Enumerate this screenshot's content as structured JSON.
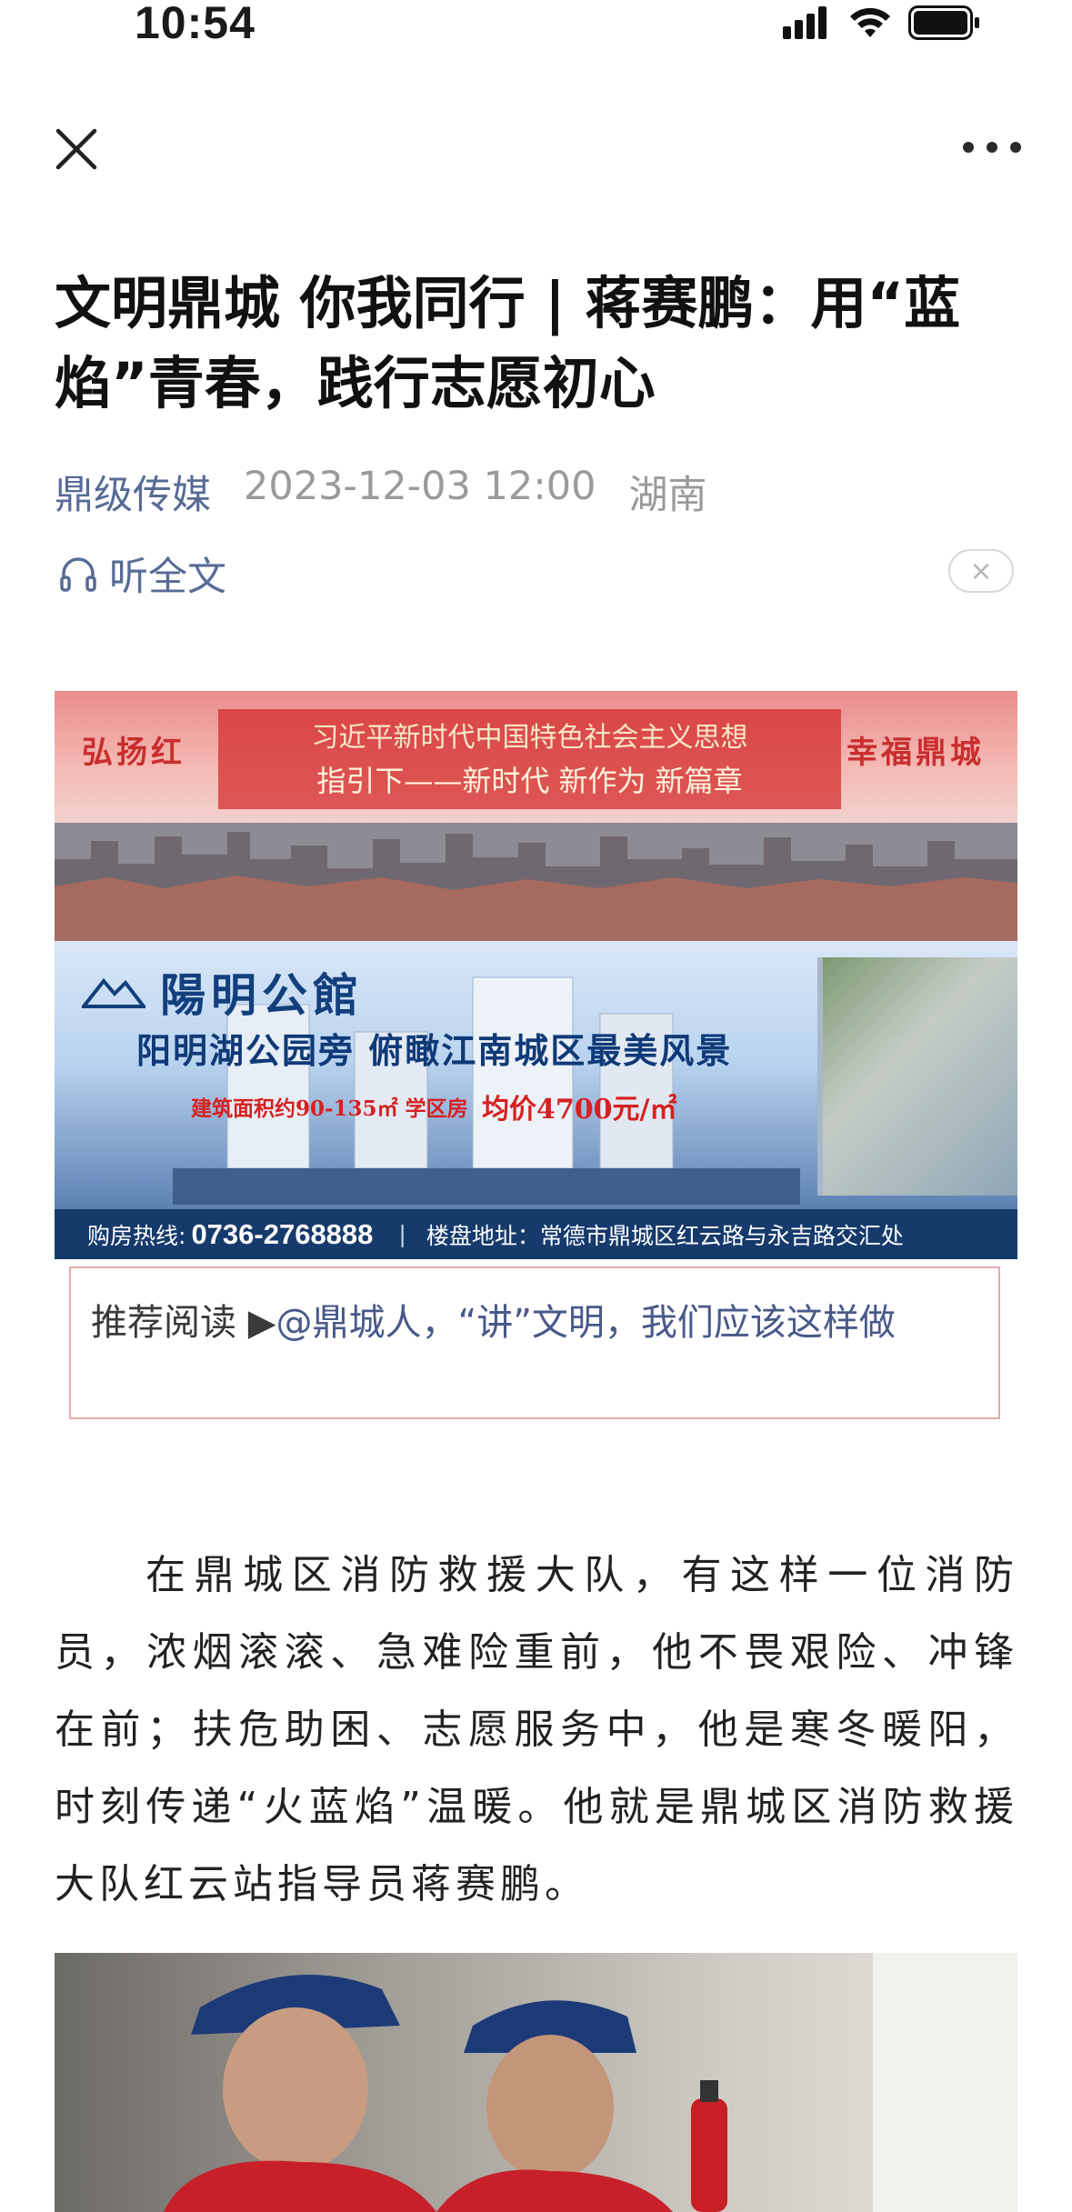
{
  "status_bar": {
    "time": "10:54"
  },
  "nav": {
    "close_icon": "close-icon",
    "more_icon": "more-icon"
  },
  "article": {
    "title": "文明鼎城 你我同行 | 蒋赛鹏：用“蓝焰”青春，践行志愿初心",
    "source": "鼎级传媒",
    "datetime": "2023-12-03 12:00",
    "location": "湖南",
    "listen_label": "听全文",
    "close_glyph": "×"
  },
  "banner": {
    "slogan_left": "弘扬红",
    "slogan_right": "幸福鼎城",
    "box_line1": "习近平新时代中国特色社会主义思想",
    "box_line2": "指引下——新时代 新作为 新篇章",
    "developer_name": "陽明公館",
    "headline": "阳明湖公园旁  俯瞰江南城区最美风景",
    "area_text": "建筑面积约90-135㎡ 学区房",
    "price_text": "均价4700元/㎡",
    "hotline_label": "购房热线:",
    "hotline_number": "0736-2768888",
    "separator": "|",
    "address": "楼盘地址：常德市鼎城区红云路与永吉路交汇处"
  },
  "recommend": {
    "label": "推荐阅读 ▶",
    "link_text": "@鼎城人，“讲”文明，我们应该这样做"
  },
  "body": {
    "paragraph": "在鼎城区消防救援大队，有这样一位消防员，浓烟滚滚、急难险重前，他不畏艰险、冲锋在前；扶危助困、志愿服务中，他是寒冬暖阳，时刻传递“火蓝焰”温暖。他就是鼎城区消防救援大队红云站指导员蒋赛鹏。"
  },
  "colors": {
    "link": "#576b95",
    "meta_gray": "#9a9a9a",
    "recommend_border": "#e6a9b0",
    "banner_navy": "#163a6b",
    "banner_red": "#c92e2e"
  }
}
